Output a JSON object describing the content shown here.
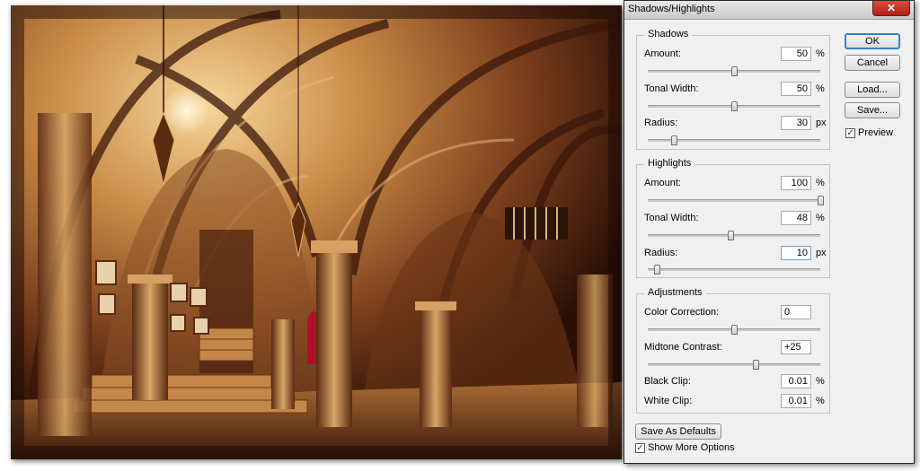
{
  "dialog": {
    "title": "Shadows/Highlights",
    "close_glyph": "✕",
    "buttons": {
      "ok": "OK",
      "cancel": "Cancel",
      "load": "Load...",
      "save": "Save..."
    },
    "preview": {
      "label": "Preview",
      "checked": true
    },
    "shadows": {
      "label": "Shadows",
      "amount": {
        "label": "Amount:",
        "value": "50",
        "unit": "%",
        "fraction": 0.5
      },
      "tonal_width": {
        "label": "Tonal Width:",
        "value": "50",
        "unit": "%",
        "fraction": 0.5
      },
      "radius": {
        "label": "Radius:",
        "value": "30",
        "unit": "px",
        "fraction": 0.15
      }
    },
    "highlights": {
      "label": "Highlights",
      "amount": {
        "label": "Amount:",
        "value": "100",
        "unit": "%",
        "fraction": 1.0
      },
      "tonal_width": {
        "label": "Tonal Width:",
        "value": "48",
        "unit": "%",
        "fraction": 0.48
      },
      "radius": {
        "label": "Radius:",
        "value": "10",
        "unit": "px",
        "fraction": 0.05
      }
    },
    "adjustments": {
      "label": "Adjustments",
      "color_correction": {
        "label": "Color Correction:",
        "value": "0",
        "fraction": 0.5
      },
      "midtone_contrast": {
        "label": "Midtone Contrast:",
        "value": "+25",
        "fraction": 0.625
      },
      "black_clip": {
        "label": "Black Clip:",
        "value": "0.01",
        "unit": "%"
      },
      "white_clip": {
        "label": "White Clip:",
        "value": "0.01",
        "unit": "%"
      }
    },
    "save_defaults": "Save As Defaults",
    "show_more": {
      "label": "Show More Options",
      "checked": true
    }
  },
  "photo": {
    "subject": "vaulted-gothic-interior"
  },
  "colors": {
    "default_button_border": "#3c7fd0",
    "close_button": "#c8321f",
    "dialog_bg": "#f0f0f0"
  }
}
